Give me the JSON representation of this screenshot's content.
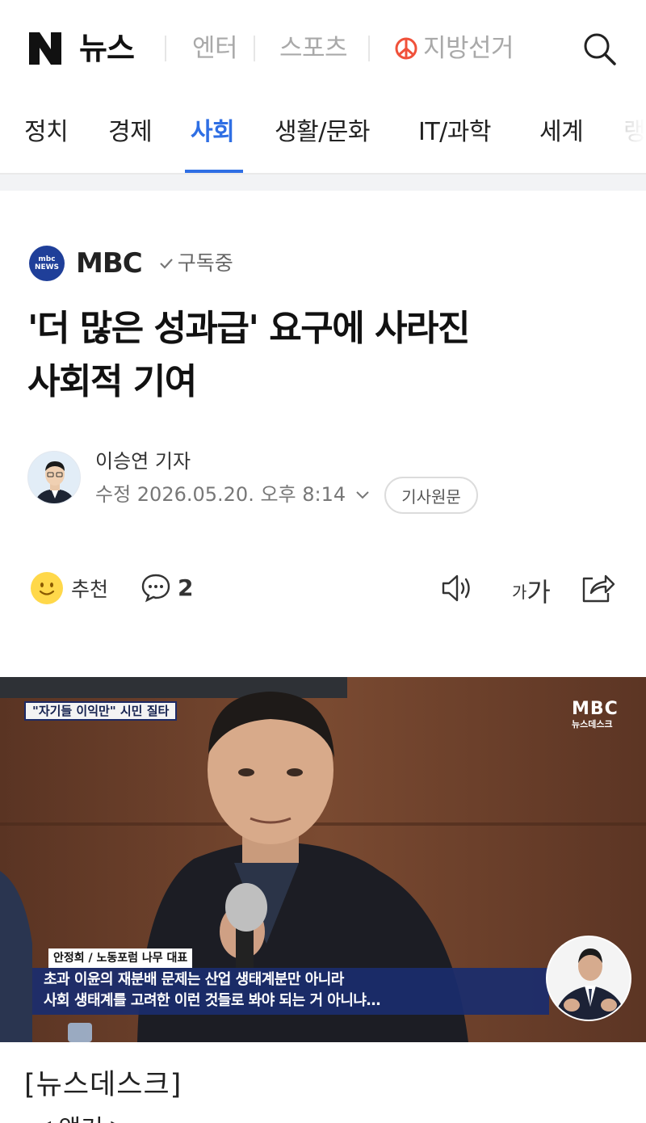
{
  "header": {
    "logo_letter": "N",
    "logo_text": "뉴스",
    "links": [
      "엔터",
      "스포츠"
    ],
    "election_label": "지방선거",
    "search_icon": "search-icon"
  },
  "categories": {
    "items": [
      "정치",
      "경제",
      "사회",
      "생활/문화",
      "IT/과학",
      "세계",
      "랭"
    ],
    "active": "사회",
    "accent_color": "#2f6fe4"
  },
  "article": {
    "press_name": "MBC",
    "press_logo_lines": [
      "mbc",
      "NEWS"
    ],
    "subscribe_label": "구독중",
    "headline_lines": [
      "'더 많은 성과급' 요구에 사라진",
      "사회적 기여"
    ],
    "reporter": "이승연 기자",
    "edit_date": "수정 2026.05.20. 오후 8:14",
    "original_button": "기사원문"
  },
  "actions": {
    "like_label": "추천",
    "comment_count": "2",
    "font_small": "가",
    "font_big": "가"
  },
  "video": {
    "caption_top": "\"자기들 이익만\" 시민 질타",
    "channel_mark": "MBC",
    "channel_sub": "뉴스데스크",
    "speaker": "안정희 / 노동포럼 나무 대표",
    "subtitle_lines": [
      "초과 이윤의 재분배 문제는 산업 생태계분만 아니라",
      "사회 생태계를 고려한 이런 것들로 봐야 되는 거 아니냐…"
    ]
  },
  "body": {
    "label": "[뉴스데스크]",
    "cut_line": "◀ 앵커 ▶"
  }
}
